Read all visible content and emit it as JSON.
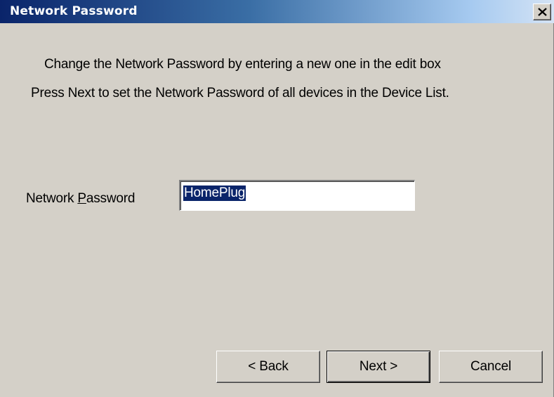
{
  "window": {
    "title": "Network Password",
    "close_glyph": "close-icon"
  },
  "instructions": {
    "line1": "Change the Network Password by entering a new one in the edit box",
    "line2": "Press Next to set the Network Password of all devices in the Device List."
  },
  "field": {
    "label_prefix": "Network ",
    "label_accel": "P",
    "label_suffix": "assword",
    "value": "HomePlug"
  },
  "buttons": {
    "back": "< Back",
    "next": "Next >",
    "cancel": "Cancel"
  },
  "colors": {
    "title_active": "#0a246a",
    "face": "#d4d0c8",
    "selection": "#0a246a"
  }
}
